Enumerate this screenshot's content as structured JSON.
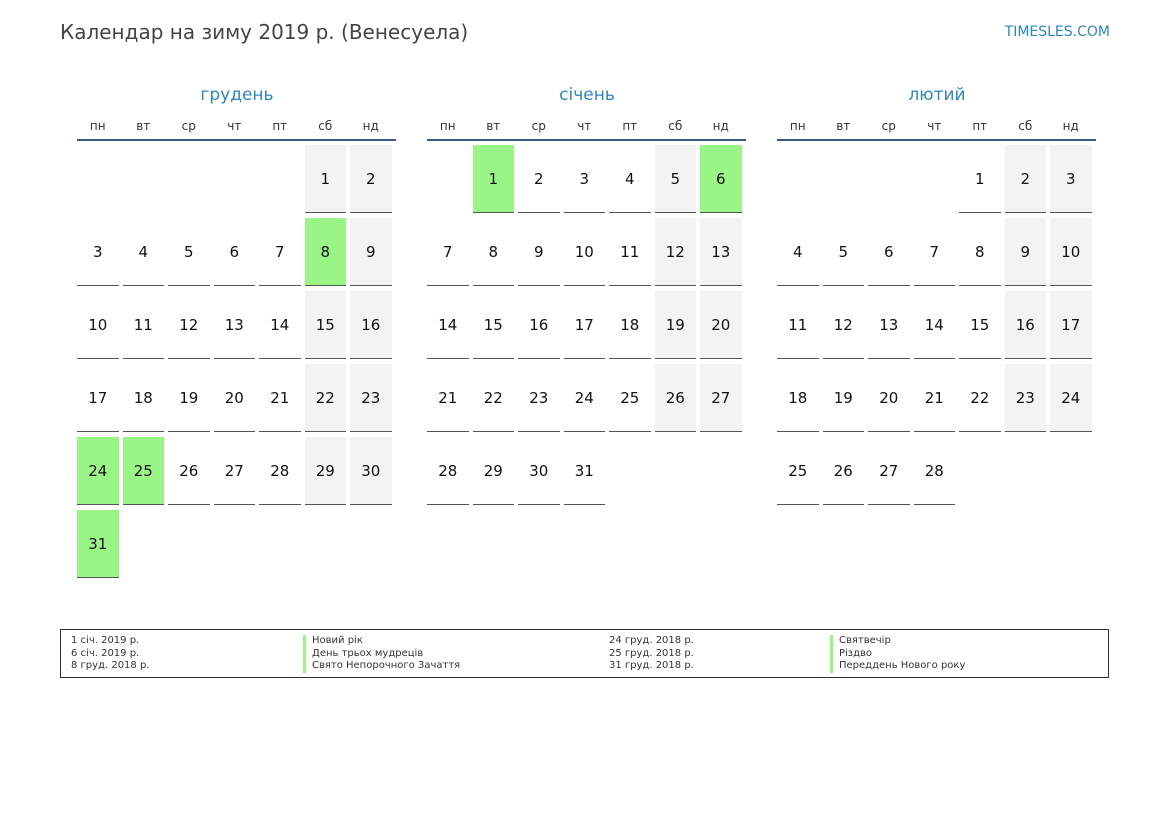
{
  "page": {
    "title": "Календар на зиму 2019 р. (Венесуела)",
    "brand": "TIMESLES.COM"
  },
  "colors": {
    "accent": "#2f86c6",
    "holiday": "#99f585",
    "weekend": "#f3f3f3",
    "rule": "#3a5a84"
  },
  "weekdays": [
    "пн",
    "вт",
    "ср",
    "чт",
    "пт",
    "сб",
    "нд"
  ],
  "months": [
    {
      "name": "грудень",
      "first_weekday": 5,
      "days": 31,
      "holidays": [
        8,
        24,
        25,
        31
      ]
    },
    {
      "name": "січень",
      "first_weekday": 1,
      "days": 31,
      "holidays": [
        1,
        6
      ]
    },
    {
      "name": "лютий",
      "first_weekday": 4,
      "days": 28,
      "holidays": []
    }
  ],
  "legend": {
    "left": [
      {
        "date": "1 січ. 2019 р.",
        "name": "Новий рік"
      },
      {
        "date": "6 січ. 2019 р.",
        "name": "День трьох мудреців"
      },
      {
        "date": "8 груд. 2018 р.",
        "name": "Свято Непорочного Зачаття"
      }
    ],
    "right": [
      {
        "date": "24 груд. 2018 р.",
        "name": "Святвечір"
      },
      {
        "date": "25 груд. 2018 р.",
        "name": "Різдво"
      },
      {
        "date": "31 груд. 2018 р.",
        "name": "Переддень Нового року"
      }
    ]
  }
}
